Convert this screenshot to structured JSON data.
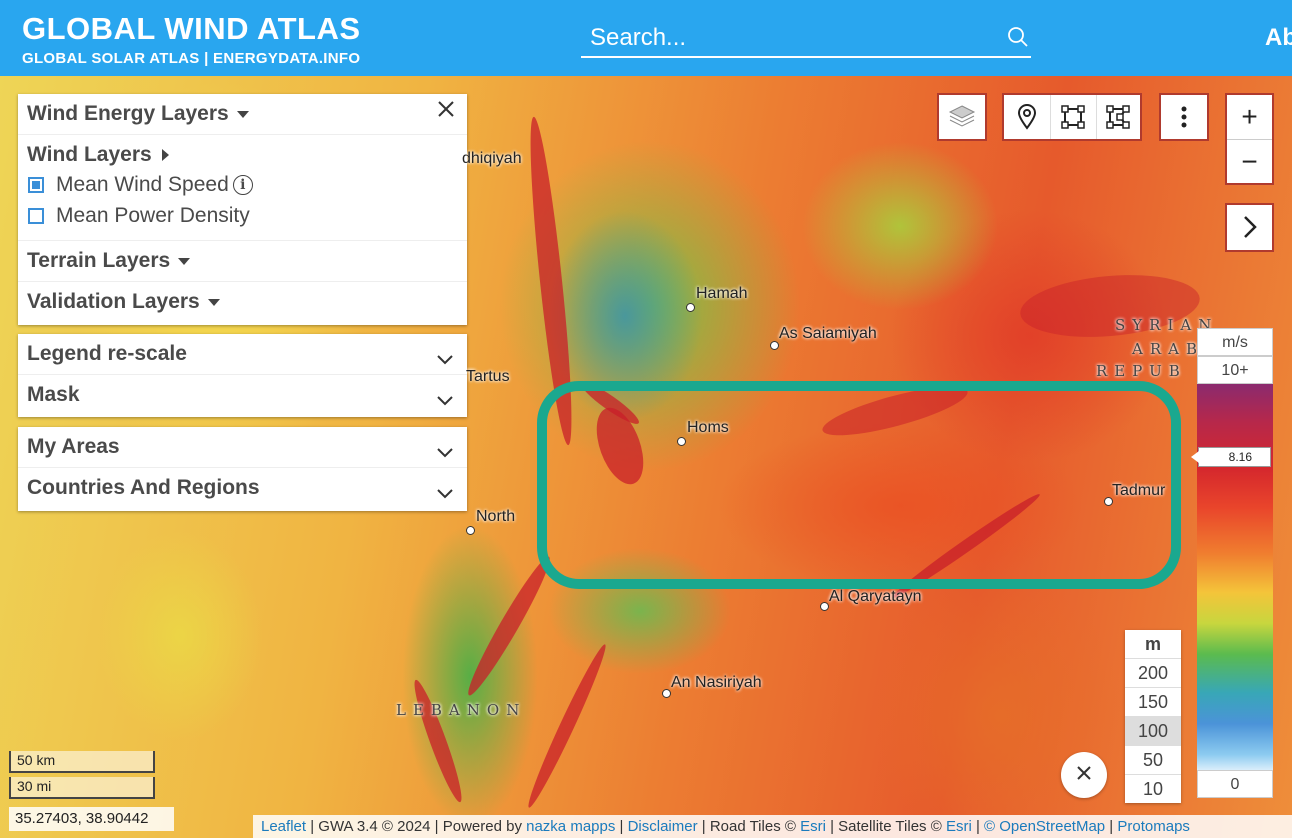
{
  "header": {
    "title": "GLOBAL WIND ATLAS",
    "subtitle": "GLOBAL SOLAR ATLAS | ENERGYDATA.INFO",
    "search_placeholder": "Search...",
    "about_label": "Ab"
  },
  "layers_panel": {
    "wind_energy_layers": "Wind Energy Layers",
    "wind_layers": "Wind Layers",
    "mean_wind_speed": "Mean Wind Speed",
    "mean_wind_speed_checked": true,
    "mean_power_density": "Mean Power Density",
    "mean_power_density_checked": false,
    "terrain_layers": "Terrain Layers",
    "validation_layers": "Validation Layers"
  },
  "panels": {
    "legend_rescale": "Legend re-scale",
    "mask": "Mask",
    "my_areas": "My Areas",
    "countries_regions": "Countries And Regions"
  },
  "map_controls": {
    "zoom_in": "+",
    "zoom_out": "−",
    "expand": "›"
  },
  "places": {
    "hamah": "Hamah",
    "as_saiamiyah": "As Saiamiyah",
    "homs": "Homs",
    "tadmur": "Tadmur",
    "al_qaryatayn": "Al Qaryatayn",
    "an_nasiriyah": "An Nasiriyah",
    "north": "North",
    "tartus": "Tartus",
    "adhiqiyah": "dhiqiyah",
    "lebanon": "LEBANON",
    "syria_1": "SYRIAN",
    "syria_2": "ARAB",
    "syria_3": "REPUB"
  },
  "legend": {
    "unit": "m/s",
    "max_label": "10+",
    "marker_value": "8.16",
    "min_label": "0"
  },
  "height_legend": {
    "unit": "m",
    "options": [
      "200",
      "150",
      "100",
      "50",
      "10"
    ],
    "selected": "100"
  },
  "scale": {
    "km": "50 km",
    "mi": "30 mi"
  },
  "coordinates": "35.27403, 38.90442",
  "attribution": {
    "leaflet": "Leaflet",
    "gwa": " | GWA 3.4 © 2024 | Powered by ",
    "nazka": "nazka mapps",
    "sep1": " | ",
    "disclaimer": "Disclaimer",
    "road": " | Road Tiles © ",
    "esri1": "Esri",
    "sat": " | Satellite Tiles © ",
    "esri2": "Esri",
    "sep2": " | ",
    "osm": "© OpenStreetMap",
    "sep3": " | ",
    "protomaps": "Protomaps"
  },
  "colors": {
    "header_bg": "#29a6ef",
    "highlight": "#1aa88f",
    "button_border": "#b03a2e"
  }
}
